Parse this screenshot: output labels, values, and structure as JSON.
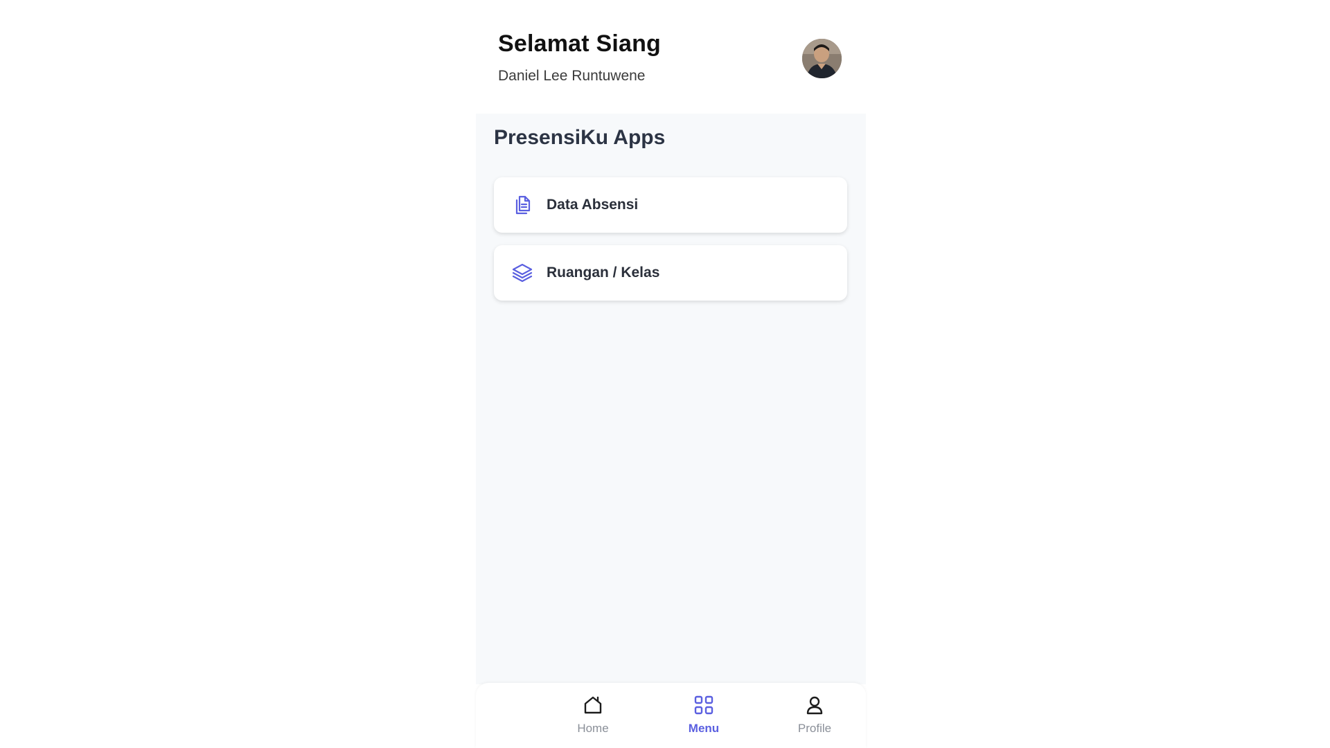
{
  "header": {
    "greeting": "Selamat Siang",
    "username": "Daniel Lee Runtuwene",
    "avatar_icon": "user-photo-avatar"
  },
  "section": {
    "title": "PresensiKu Apps"
  },
  "menu_items": [
    {
      "label": "Data Absensi",
      "icon": "documents-icon"
    },
    {
      "label": "Ruangan / Kelas",
      "icon": "layers-icon"
    }
  ],
  "bottom_nav": {
    "items": [
      {
        "label": "Home",
        "icon": "home-icon",
        "active": false
      },
      {
        "label": "Menu",
        "icon": "grid-icon",
        "active": true
      },
      {
        "label": "Profile",
        "icon": "user-icon",
        "active": false
      }
    ]
  },
  "colors": {
    "accent": "#5a5fe0",
    "content_bg": "#f7f9fb",
    "inactive_nav": "#8a8f98"
  }
}
